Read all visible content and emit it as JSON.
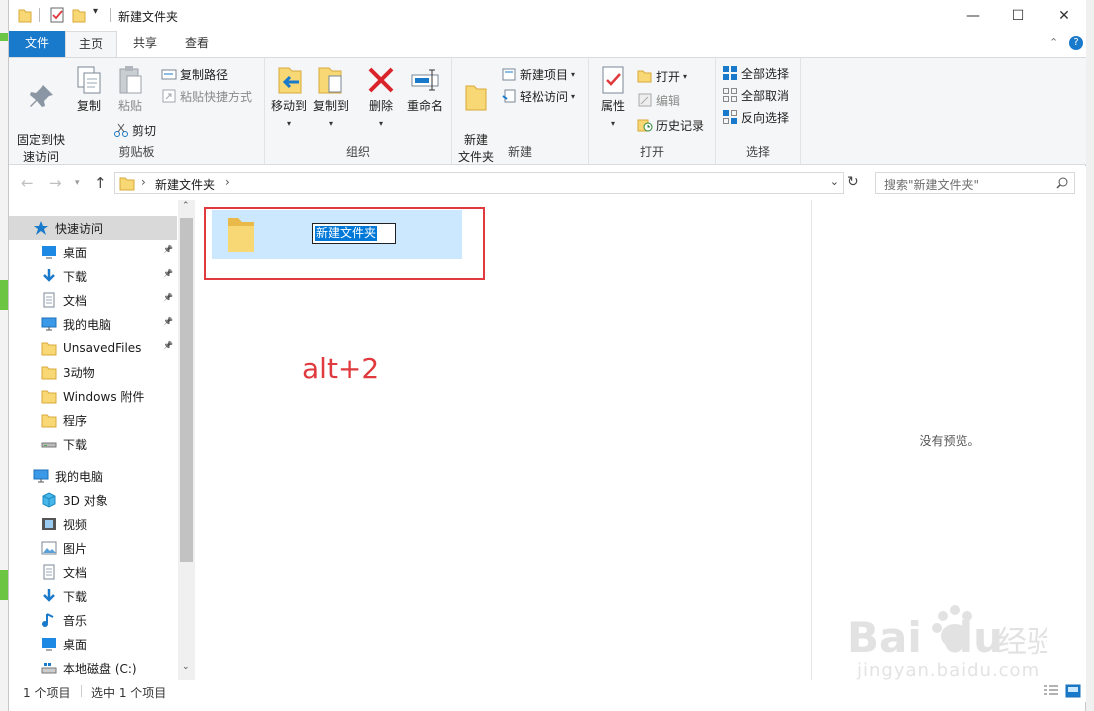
{
  "window": {
    "title": "新建文件夹",
    "controls": {
      "minimize": "—",
      "maximize": "☐",
      "close": "✕"
    }
  },
  "tabs": [
    "文件",
    "主页",
    "共享",
    "查看"
  ],
  "ribbon": {
    "clipboard": {
      "pin_label": "固定到快\n速访问",
      "copy_label": "复制",
      "paste_label": "粘贴",
      "copy_path_label": "复制路径",
      "paste_shortcut_label": "粘贴快捷方式",
      "cut_label": "剪切",
      "group_label": "剪贴板"
    },
    "organize": {
      "move_to_label": "移动到",
      "copy_to_label": "复制到",
      "delete_label": "删除",
      "rename_label": "重命名",
      "group_label": "组织"
    },
    "new": {
      "new_folder_label": "新建\n文件夹",
      "new_item_label": "新建项目",
      "easy_access_label": "轻松访问",
      "group_label": "新建"
    },
    "open": {
      "properties_label": "属性",
      "open_label": "打开",
      "edit_label": "编辑",
      "history_label": "历史记录",
      "group_label": "打开"
    },
    "select": {
      "select_all_label": "全部选择",
      "select_none_label": "全部取消",
      "invert_label": "反向选择",
      "group_label": "选择"
    }
  },
  "address": {
    "path": "新建文件夹",
    "search_placeholder": "搜索\"新建文件夹\""
  },
  "nav": {
    "quick_access": "快速访问",
    "quick_items": [
      {
        "label": "桌面",
        "icon": "desktop-icon"
      },
      {
        "label": "下载",
        "icon": "download-icon"
      },
      {
        "label": "文档",
        "icon": "document-icon"
      },
      {
        "label": "我的电脑",
        "icon": "computer-icon"
      },
      {
        "label": "UnsavedFiles",
        "icon": "folder-icon"
      },
      {
        "label": "3动物",
        "icon": "folder-icon"
      },
      {
        "label": "Windows 附件",
        "icon": "folder-icon"
      },
      {
        "label": "程序",
        "icon": "folder-icon"
      },
      {
        "label": "下载",
        "icon": "drive-icon"
      }
    ],
    "this_pc": "我的电脑",
    "pc_items": [
      {
        "label": "3D 对象",
        "icon": "3d-objects-icon"
      },
      {
        "label": "视频",
        "icon": "video-icon"
      },
      {
        "label": "图片",
        "icon": "pictures-icon"
      },
      {
        "label": "文档",
        "icon": "document-icon"
      },
      {
        "label": "下载",
        "icon": "download-icon"
      },
      {
        "label": "音乐",
        "icon": "music-icon"
      },
      {
        "label": "桌面",
        "icon": "desktop-icon"
      },
      {
        "label": "本地磁盘 (C:)",
        "icon": "local-disk-icon"
      }
    ]
  },
  "content": {
    "item_name": "新建文件夹",
    "annotation": "alt+2"
  },
  "preview": {
    "text": "没有预览。"
  },
  "status": {
    "count": "1 个项目",
    "selected": "选中 1 个项目"
  },
  "watermark": {
    "url": "jingyan.baidu.com"
  },
  "colors": {
    "accent": "#1979ca",
    "selection": "#cce8ff",
    "annotation": "#e0393e",
    "folder": "#f8d775"
  }
}
